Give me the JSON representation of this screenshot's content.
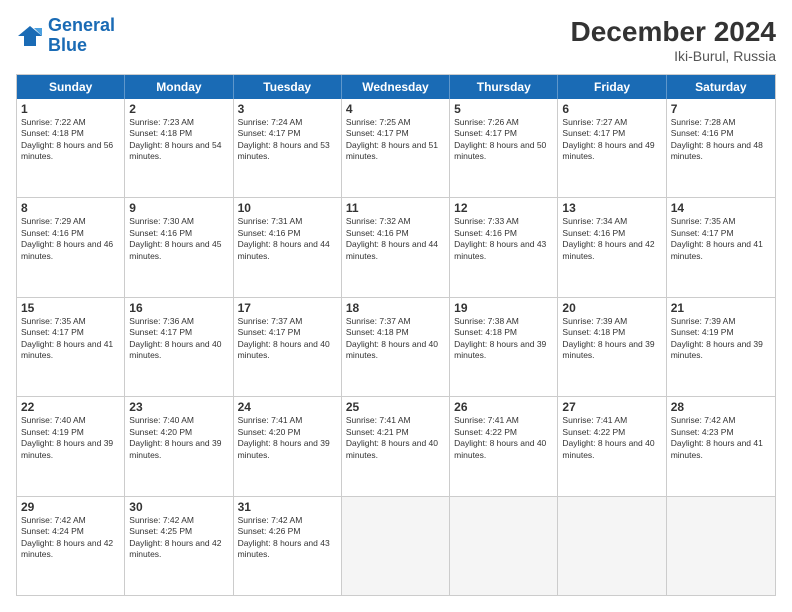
{
  "header": {
    "logo_line1": "General",
    "logo_line2": "Blue",
    "month_year": "December 2024",
    "location": "Iki-Burul, Russia"
  },
  "days_of_week": [
    "Sunday",
    "Monday",
    "Tuesday",
    "Wednesday",
    "Thursday",
    "Friday",
    "Saturday"
  ],
  "weeks": [
    [
      {
        "day": "1",
        "sunrise": "7:22 AM",
        "sunset": "4:18 PM",
        "daylight": "8 hours and 56 minutes."
      },
      {
        "day": "2",
        "sunrise": "7:23 AM",
        "sunset": "4:18 PM",
        "daylight": "8 hours and 54 minutes."
      },
      {
        "day": "3",
        "sunrise": "7:24 AM",
        "sunset": "4:17 PM",
        "daylight": "8 hours and 53 minutes."
      },
      {
        "day": "4",
        "sunrise": "7:25 AM",
        "sunset": "4:17 PM",
        "daylight": "8 hours and 51 minutes."
      },
      {
        "day": "5",
        "sunrise": "7:26 AM",
        "sunset": "4:17 PM",
        "daylight": "8 hours and 50 minutes."
      },
      {
        "day": "6",
        "sunrise": "7:27 AM",
        "sunset": "4:17 PM",
        "daylight": "8 hours and 49 minutes."
      },
      {
        "day": "7",
        "sunrise": "7:28 AM",
        "sunset": "4:16 PM",
        "daylight": "8 hours and 48 minutes."
      }
    ],
    [
      {
        "day": "8",
        "sunrise": "7:29 AM",
        "sunset": "4:16 PM",
        "daylight": "8 hours and 46 minutes."
      },
      {
        "day": "9",
        "sunrise": "7:30 AM",
        "sunset": "4:16 PM",
        "daylight": "8 hours and 45 minutes."
      },
      {
        "day": "10",
        "sunrise": "7:31 AM",
        "sunset": "4:16 PM",
        "daylight": "8 hours and 44 minutes."
      },
      {
        "day": "11",
        "sunrise": "7:32 AM",
        "sunset": "4:16 PM",
        "daylight": "8 hours and 44 minutes."
      },
      {
        "day": "12",
        "sunrise": "7:33 AM",
        "sunset": "4:16 PM",
        "daylight": "8 hours and 43 minutes."
      },
      {
        "day": "13",
        "sunrise": "7:34 AM",
        "sunset": "4:16 PM",
        "daylight": "8 hours and 42 minutes."
      },
      {
        "day": "14",
        "sunrise": "7:35 AM",
        "sunset": "4:17 PM",
        "daylight": "8 hours and 41 minutes."
      }
    ],
    [
      {
        "day": "15",
        "sunrise": "7:35 AM",
        "sunset": "4:17 PM",
        "daylight": "8 hours and 41 minutes."
      },
      {
        "day": "16",
        "sunrise": "7:36 AM",
        "sunset": "4:17 PM",
        "daylight": "8 hours and 40 minutes."
      },
      {
        "day": "17",
        "sunrise": "7:37 AM",
        "sunset": "4:17 PM",
        "daylight": "8 hours and 40 minutes."
      },
      {
        "day": "18",
        "sunrise": "7:37 AM",
        "sunset": "4:18 PM",
        "daylight": "8 hours and 40 minutes."
      },
      {
        "day": "19",
        "sunrise": "7:38 AM",
        "sunset": "4:18 PM",
        "daylight": "8 hours and 39 minutes."
      },
      {
        "day": "20",
        "sunrise": "7:39 AM",
        "sunset": "4:18 PM",
        "daylight": "8 hours and 39 minutes."
      },
      {
        "day": "21",
        "sunrise": "7:39 AM",
        "sunset": "4:19 PM",
        "daylight": "8 hours and 39 minutes."
      }
    ],
    [
      {
        "day": "22",
        "sunrise": "7:40 AM",
        "sunset": "4:19 PM",
        "daylight": "8 hours and 39 minutes."
      },
      {
        "day": "23",
        "sunrise": "7:40 AM",
        "sunset": "4:20 PM",
        "daylight": "8 hours and 39 minutes."
      },
      {
        "day": "24",
        "sunrise": "7:41 AM",
        "sunset": "4:20 PM",
        "daylight": "8 hours and 39 minutes."
      },
      {
        "day": "25",
        "sunrise": "7:41 AM",
        "sunset": "4:21 PM",
        "daylight": "8 hours and 40 minutes."
      },
      {
        "day": "26",
        "sunrise": "7:41 AM",
        "sunset": "4:22 PM",
        "daylight": "8 hours and 40 minutes."
      },
      {
        "day": "27",
        "sunrise": "7:41 AM",
        "sunset": "4:22 PM",
        "daylight": "8 hours and 40 minutes."
      },
      {
        "day": "28",
        "sunrise": "7:42 AM",
        "sunset": "4:23 PM",
        "daylight": "8 hours and 41 minutes."
      }
    ],
    [
      {
        "day": "29",
        "sunrise": "7:42 AM",
        "sunset": "4:24 PM",
        "daylight": "8 hours and 42 minutes."
      },
      {
        "day": "30",
        "sunrise": "7:42 AM",
        "sunset": "4:25 PM",
        "daylight": "8 hours and 42 minutes."
      },
      {
        "day": "31",
        "sunrise": "7:42 AM",
        "sunset": "4:26 PM",
        "daylight": "8 hours and 43 minutes."
      },
      null,
      null,
      null,
      null
    ]
  ]
}
